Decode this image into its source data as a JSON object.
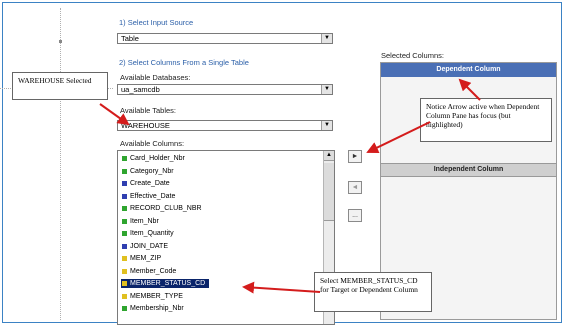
{
  "step1": {
    "heading": "1) Select Input Source",
    "source_value": "Table"
  },
  "step2": {
    "heading": "2) Select Columns From a Single Table",
    "databases_label": "Available Databases:",
    "database_value": "ua_samcdb",
    "tables_label": "Available Tables:",
    "table_value": "WAREHOUSE",
    "columns_label": "Available Columns:"
  },
  "columns": [
    {
      "name": "Card_Holder_Nbr",
      "icon_color": "#2fa52f"
    },
    {
      "name": "Category_Nbr",
      "icon_color": "#2fa52f"
    },
    {
      "name": "Create_Date",
      "icon_color": "#2f3fb0"
    },
    {
      "name": "Effective_Date",
      "icon_color": "#2f3fb0"
    },
    {
      "name": "RECORD_CLUB_NBR",
      "icon_color": "#2fa52f"
    },
    {
      "name": "Item_Nbr",
      "icon_color": "#2fa52f"
    },
    {
      "name": "Item_Quantity",
      "icon_color": "#2fa52f"
    },
    {
      "name": "JOIN_DATE",
      "icon_color": "#2f3fb0"
    },
    {
      "name": "MEM_ZIP",
      "icon_color": "#e0c020"
    },
    {
      "name": "Member_Code",
      "icon_color": "#e0c020"
    },
    {
      "name": "MEMBER_STATUS_CD",
      "icon_color": "#e0c020"
    },
    {
      "name": "MEMBER_TYPE",
      "icon_color": "#e0c020"
    },
    {
      "name": "Membership_Nbr",
      "icon_color": "#2fa52f"
    }
  ],
  "selected_column_index": 10,
  "move_buttons": {
    "right": "►",
    "left": "◄",
    "more": "..."
  },
  "selected_columns": {
    "label": "Selected Columns:",
    "dependent_header": "Dependent Column",
    "independent_header": "Independent Column"
  },
  "callouts": {
    "warehouse": "WAREHOUSE Selected",
    "arrow_note": "Notice Arrow active when Dependent Column Pane has focus (but highlighted)",
    "select_note": "Select MEMBER_STATUS_CD for Target or Dependent Column"
  },
  "colors": {
    "accent": "#4a6fb5",
    "selection": "#0a246a",
    "annotation_arrow": "#d41c1c",
    "heading": "#2b5fa8"
  }
}
